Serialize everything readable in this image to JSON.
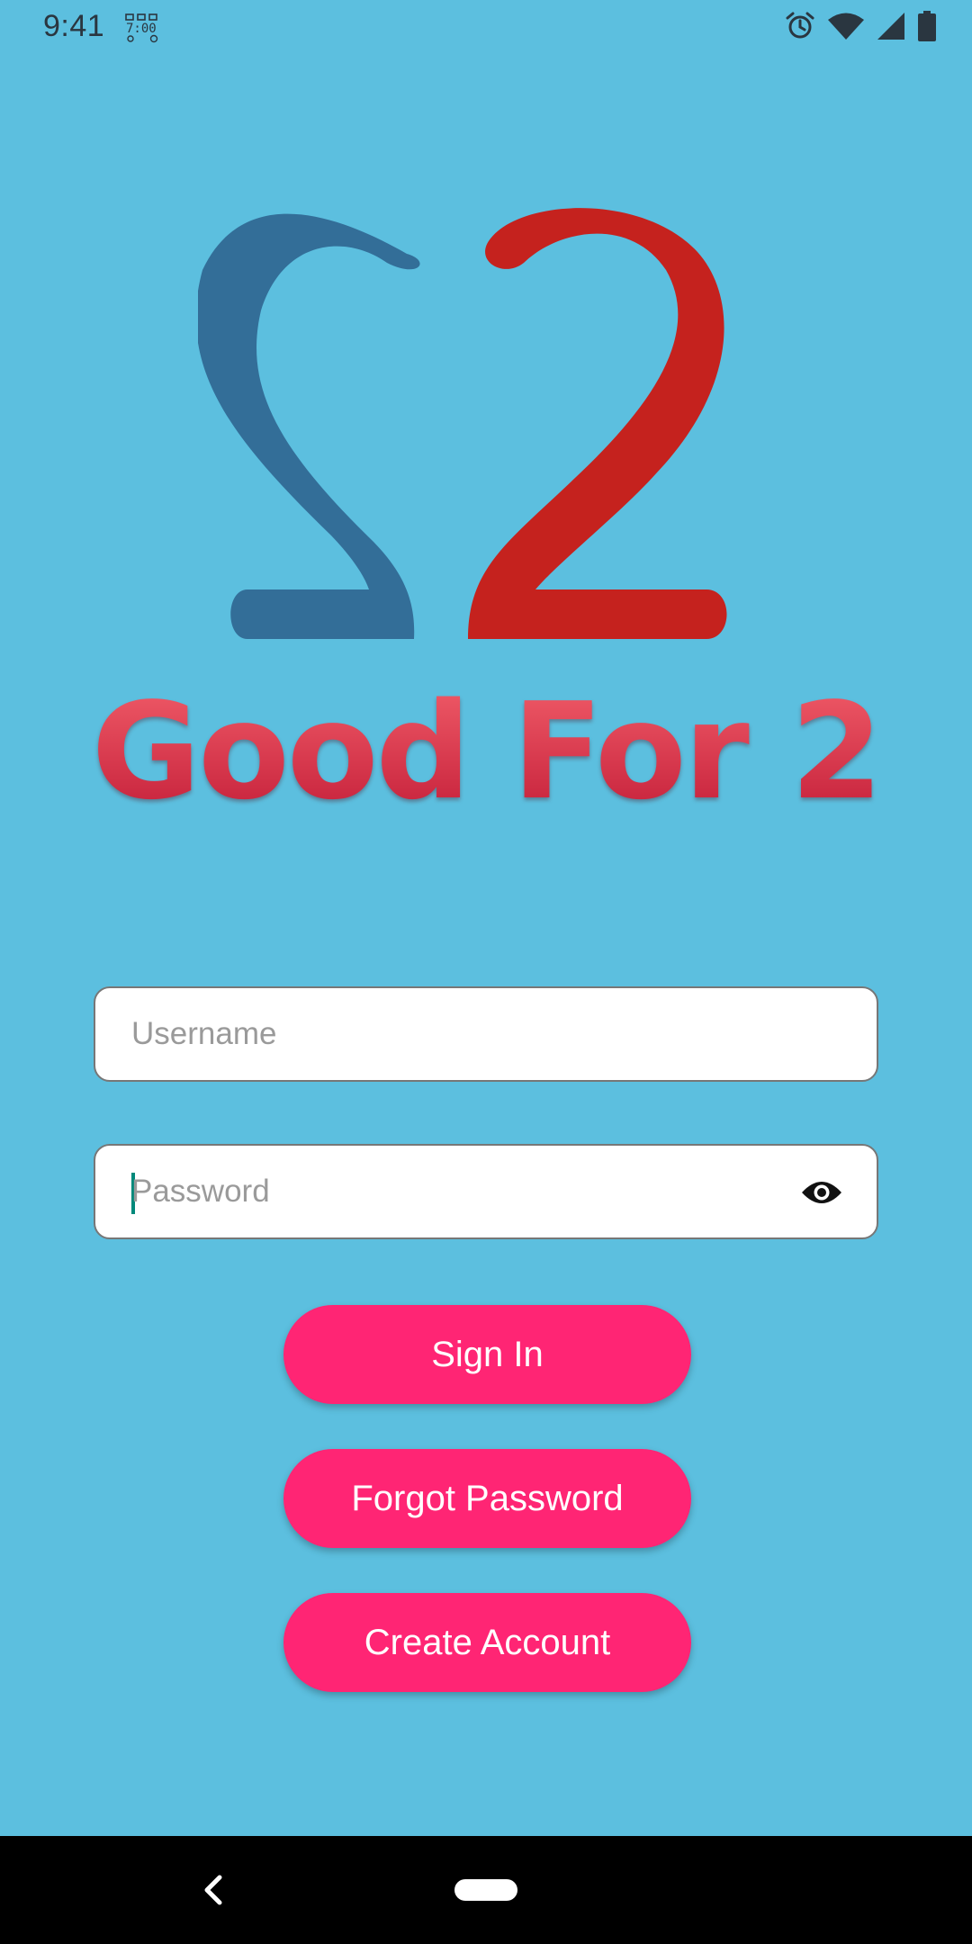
{
  "status_bar": {
    "time": "9:41"
  },
  "brand": {
    "title": "Good For 2"
  },
  "form": {
    "username_placeholder": "Username",
    "password_placeholder": "Password"
  },
  "buttons": {
    "sign_in": "Sign In",
    "forgot_password": "Forgot Password",
    "create_account": "Create Account"
  },
  "icons": {
    "status": [
      "alarm-icon",
      "wifi-icon",
      "signal-icon",
      "battery-icon"
    ],
    "password_toggle": "eye-icon",
    "nav": [
      "back-icon",
      "home-pill"
    ]
  },
  "colors": {
    "background": "#5CBFDF",
    "button": "#FF2574",
    "logo_blue": "#336E98",
    "logo_red": "#C5221E",
    "title_red": "#D93346"
  }
}
